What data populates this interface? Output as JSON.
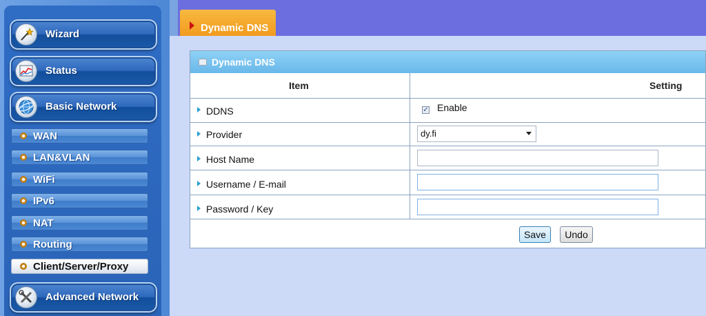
{
  "sidebar": {
    "main_buttons": [
      {
        "label": "Wizard",
        "icon": "wizard-wand-icon"
      },
      {
        "label": "Status",
        "icon": "status-chart-icon"
      },
      {
        "label": "Basic Network",
        "icon": "globe-icon"
      },
      {
        "label": "Advanced Network",
        "icon": "tools-icon"
      }
    ],
    "sub_items": [
      {
        "label": "WAN"
      },
      {
        "label": "LAN&VLAN"
      },
      {
        "label": "WiFi"
      },
      {
        "label": "IPv6"
      },
      {
        "label": "NAT"
      },
      {
        "label": "Routing"
      },
      {
        "label": "Client/Server/Proxy",
        "active": true
      }
    ]
  },
  "page_tab": {
    "title": "Dynamic DNS"
  },
  "panel": {
    "title": "Dynamic DNS",
    "col_item": "Item",
    "col_setting": "Setting",
    "rows": [
      {
        "label": "DDNS",
        "type": "checkbox",
        "checked": true,
        "checkbox_label": "Enable"
      },
      {
        "label": "Provider",
        "type": "select",
        "value": "dy.fi"
      },
      {
        "label": "Host Name",
        "type": "text",
        "value": ""
      },
      {
        "label": "Username / E-mail",
        "type": "text",
        "value": ""
      },
      {
        "label": "Password / Key",
        "type": "password",
        "value": ""
      }
    ],
    "buttons": {
      "save": "Save",
      "undo": "Undo"
    }
  },
  "colors": {
    "accent_orange": "#f29b1e",
    "header_bar": "#6c6ee0",
    "panel_header": "#69b8ea",
    "sidebar_blue": "#2a64b8"
  }
}
